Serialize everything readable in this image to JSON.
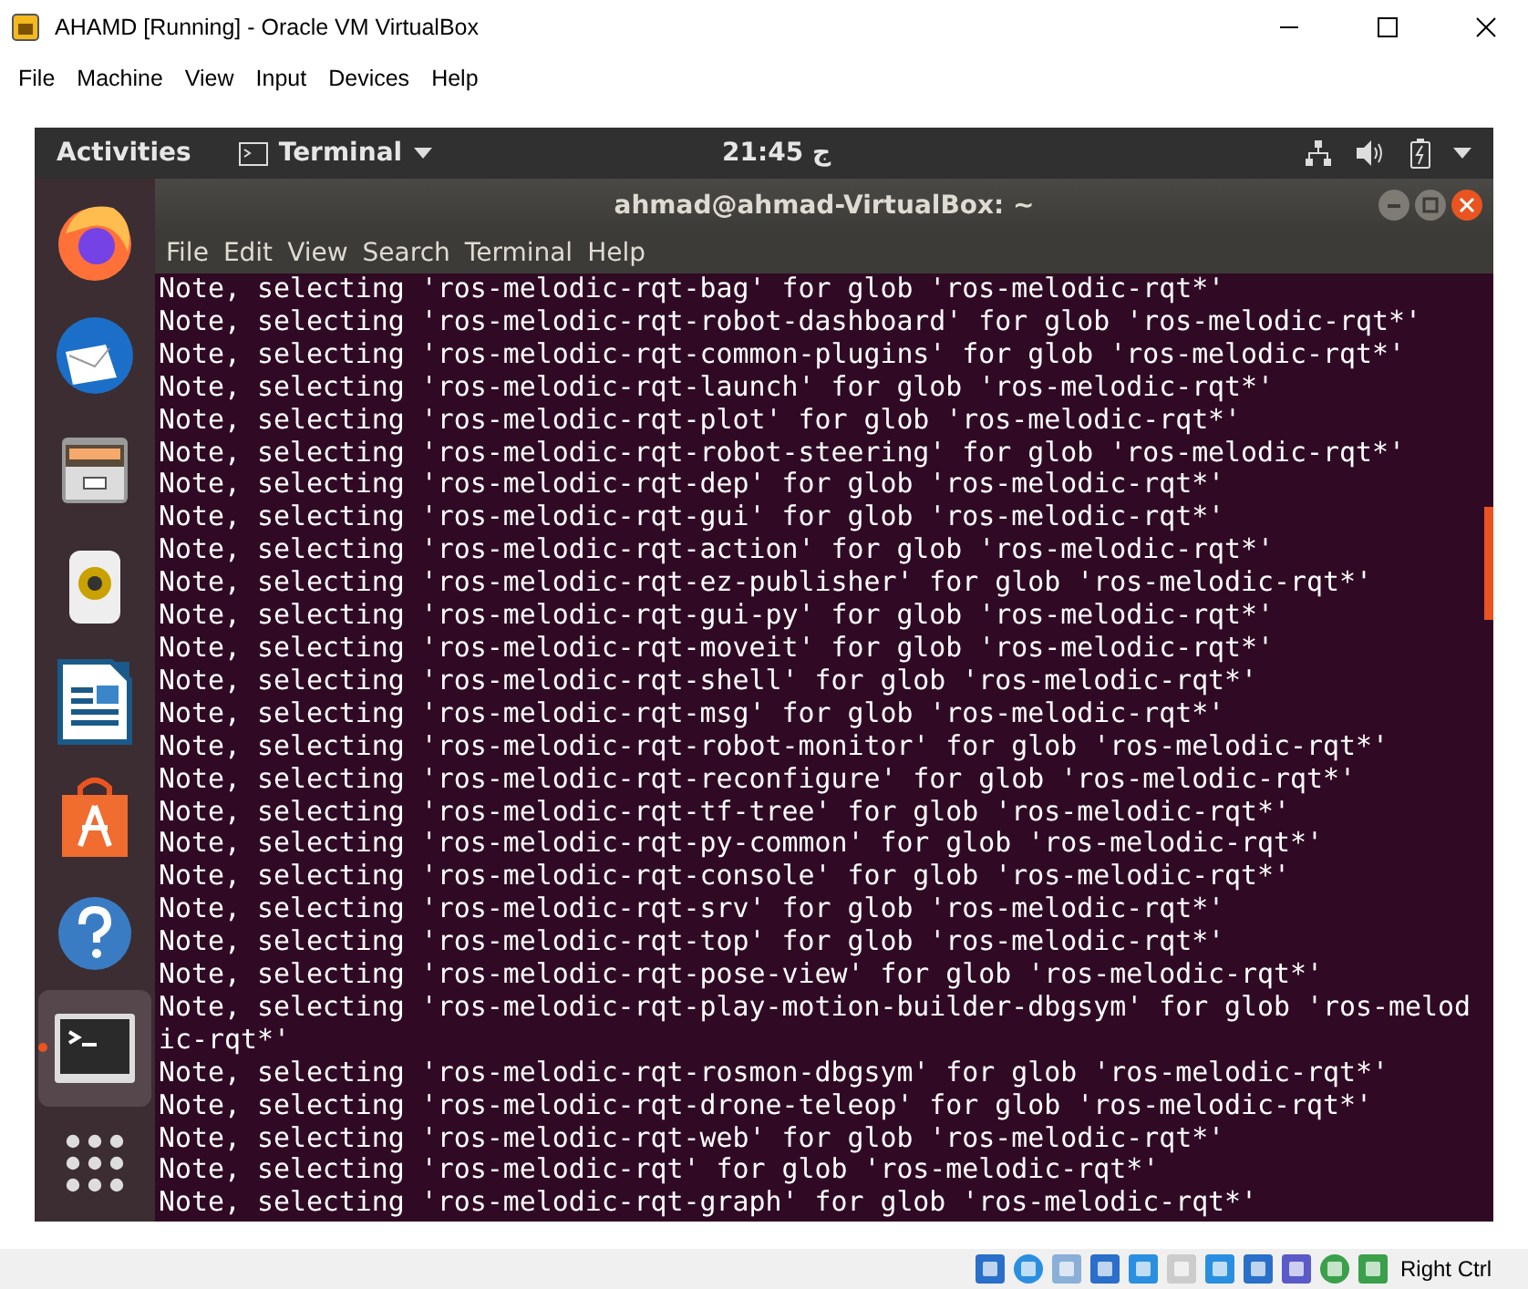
{
  "window": {
    "title": "AHAMD [Running] - Oracle VM VirtualBox"
  },
  "menu": [
    "File",
    "Machine",
    "View",
    "Input",
    "Devices",
    "Help"
  ],
  "guest_topbar": {
    "activities": "Activities",
    "app_menu": "Terminal",
    "clock": "21:45 ج"
  },
  "dock": [
    {
      "kind": "firefox",
      "selected": false
    },
    {
      "kind": "mail",
      "selected": false
    },
    {
      "kind": "files",
      "selected": false
    },
    {
      "kind": "speaker",
      "selected": false
    },
    {
      "kind": "document",
      "selected": false
    },
    {
      "kind": "store",
      "selected": false
    },
    {
      "kind": "help",
      "selected": false
    },
    {
      "kind": "terminal",
      "selected": true
    },
    {
      "kind": "apps",
      "selected": false
    }
  ],
  "terminal": {
    "title": "ahmad@ahmad-VirtualBox: ~",
    "menu": [
      "File",
      "Edit",
      "View",
      "Search",
      "Terminal",
      "Help"
    ],
    "lines": [
      "Note, selecting 'ros-melodic-rqt-bag' for glob 'ros-melodic-rqt*'",
      "Note, selecting 'ros-melodic-rqt-robot-dashboard' for glob 'ros-melodic-rqt*'",
      "Note, selecting 'ros-melodic-rqt-common-plugins' for glob 'ros-melodic-rqt*'",
      "Note, selecting 'ros-melodic-rqt-launch' for glob 'ros-melodic-rqt*'",
      "Note, selecting 'ros-melodic-rqt-plot' for glob 'ros-melodic-rqt*'",
      "Note, selecting 'ros-melodic-rqt-robot-steering' for glob 'ros-melodic-rqt*'",
      "Note, selecting 'ros-melodic-rqt-dep' for glob 'ros-melodic-rqt*'",
      "Note, selecting 'ros-melodic-rqt-gui' for glob 'ros-melodic-rqt*'",
      "Note, selecting 'ros-melodic-rqt-action' for glob 'ros-melodic-rqt*'",
      "Note, selecting 'ros-melodic-rqt-ez-publisher' for glob 'ros-melodic-rqt*'",
      "Note, selecting 'ros-melodic-rqt-gui-py' for glob 'ros-melodic-rqt*'",
      "Note, selecting 'ros-melodic-rqt-moveit' for glob 'ros-melodic-rqt*'",
      "Note, selecting 'ros-melodic-rqt-shell' for glob 'ros-melodic-rqt*'",
      "Note, selecting 'ros-melodic-rqt-msg' for glob 'ros-melodic-rqt*'",
      "Note, selecting 'ros-melodic-rqt-robot-monitor' for glob 'ros-melodic-rqt*'",
      "Note, selecting 'ros-melodic-rqt-reconfigure' for glob 'ros-melodic-rqt*'",
      "Note, selecting 'ros-melodic-rqt-tf-tree' for glob 'ros-melodic-rqt*'",
      "Note, selecting 'ros-melodic-rqt-py-common' for glob 'ros-melodic-rqt*'",
      "Note, selecting 'ros-melodic-rqt-console' for glob 'ros-melodic-rqt*'",
      "Note, selecting 'ros-melodic-rqt-srv' for glob 'ros-melodic-rqt*'",
      "Note, selecting 'ros-melodic-rqt-top' for glob 'ros-melodic-rqt*'",
      "Note, selecting 'ros-melodic-rqt-pose-view' for glob 'ros-melodic-rqt*'",
      "Note, selecting 'ros-melodic-rqt-play-motion-builder-dbgsym' for glob 'ros-melodic-rqt*'",
      "Note, selecting 'ros-melodic-rqt-rosmon-dbgsym' for glob 'ros-melodic-rqt*'",
      "Note, selecting 'ros-melodic-rqt-drone-teleop' for glob 'ros-melodic-rqt*'",
      "Note, selecting 'ros-melodic-rqt-web' for glob 'ros-melodic-rqt*'",
      "Note, selecting 'ros-melodic-rqt' for glob 'ros-melodic-rqt*'",
      "Note, selecting 'ros-melodic-rqt-graph' for glob 'ros-melodic-rqt*'"
    ]
  },
  "status_bar": {
    "host_key": "Right Ctrl"
  }
}
